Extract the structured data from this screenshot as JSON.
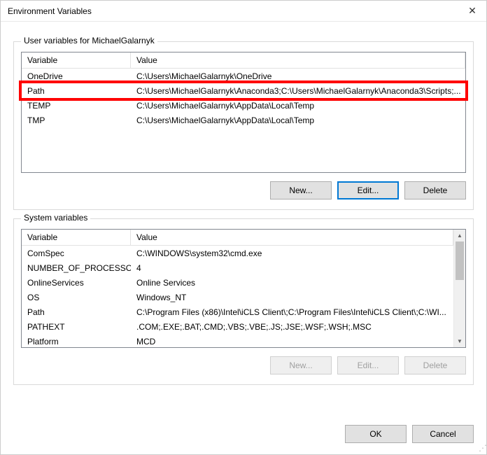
{
  "window": {
    "title": "Environment Variables"
  },
  "user_section": {
    "label": "User variables for MichaelGalarnyk",
    "columns": {
      "variable": "Variable",
      "value": "Value"
    },
    "rows": [
      {
        "variable": "OneDrive",
        "value": "C:\\Users\\MichaelGalarnyk\\OneDrive"
      },
      {
        "variable": "Path",
        "value": "C:\\Users\\MichaelGalarnyk\\Anaconda3;C:\\Users\\MichaelGalarnyk\\Anaconda3\\Scripts;..."
      },
      {
        "variable": "TEMP",
        "value": "C:\\Users\\MichaelGalarnyk\\AppData\\Local\\Temp"
      },
      {
        "variable": "TMP",
        "value": "C:\\Users\\MichaelGalarnyk\\AppData\\Local\\Temp"
      }
    ],
    "buttons": {
      "new": "New...",
      "edit": "Edit...",
      "delete": "Delete"
    }
  },
  "system_section": {
    "label": "System variables",
    "columns": {
      "variable": "Variable",
      "value": "Value"
    },
    "rows": [
      {
        "variable": "ComSpec",
        "value": "C:\\WINDOWS\\system32\\cmd.exe"
      },
      {
        "variable": "NUMBER_OF_PROCESSORS",
        "value": "4"
      },
      {
        "variable": "OnlineServices",
        "value": "Online Services"
      },
      {
        "variable": "OS",
        "value": "Windows_NT"
      },
      {
        "variable": "Path",
        "value": "C:\\Program Files (x86)\\Intel\\iCLS Client\\;C:\\Program Files\\Intel\\iCLS Client\\;C:\\WI..."
      },
      {
        "variable": "PATHEXT",
        "value": ".COM;.EXE;.BAT;.CMD;.VBS;.VBE;.JS;.JSE;.WSF;.WSH;.MSC"
      },
      {
        "variable": "Platform",
        "value": "MCD"
      }
    ],
    "buttons": {
      "new": "New...",
      "edit": "Edit...",
      "delete": "Delete"
    }
  },
  "dialog_buttons": {
    "ok": "OK",
    "cancel": "Cancel"
  }
}
